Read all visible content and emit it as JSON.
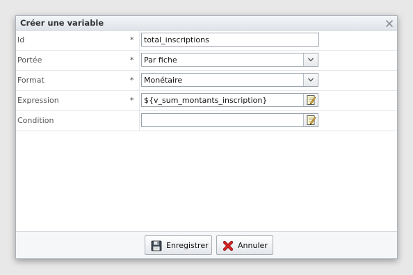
{
  "dialog": {
    "title": "Créer une variable",
    "close_icon": "close-icon"
  },
  "form": {
    "rows": [
      {
        "label": "Id",
        "required": "*",
        "type": "text",
        "value": "total_inscriptions"
      },
      {
        "label": "Portée",
        "required": "*",
        "type": "select",
        "value": "Par fiche"
      },
      {
        "label": "Format",
        "required": "*",
        "type": "select",
        "value": "Monétaire"
      },
      {
        "label": "Expression",
        "required": "*",
        "type": "editor",
        "value": "${v_sum_montants_inscription}"
      },
      {
        "label": "Condition",
        "required": "",
        "type": "editor",
        "value": ""
      }
    ]
  },
  "footer": {
    "save_label": "Enregistrer",
    "save_icon": "floppy-disk-icon",
    "cancel_label": "Annuler",
    "cancel_icon": "red-x-icon"
  }
}
